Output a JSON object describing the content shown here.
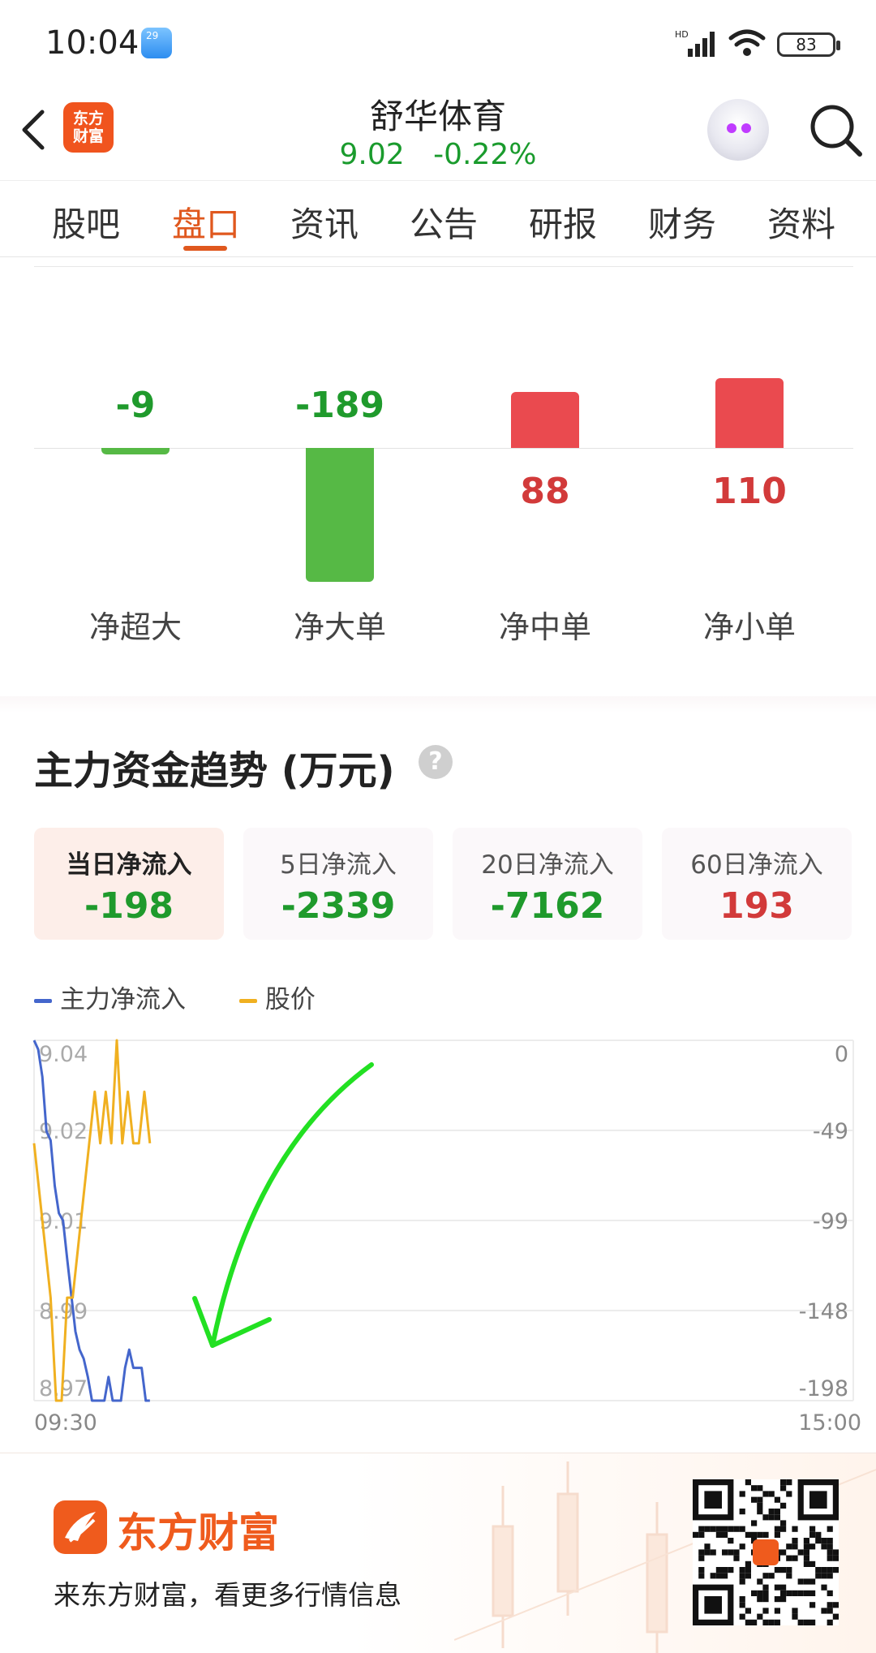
{
  "status_bar": {
    "time": "10:04",
    "weather_badge": "29",
    "battery": "83",
    "network": "HD"
  },
  "header": {
    "stock_name": "舒华体育",
    "price": "9.02",
    "change_pct": "-0.22%",
    "logo_text_line1": "东方",
    "logo_text_line2": "财富"
  },
  "tabs": [
    "股吧",
    "盘口",
    "资讯",
    "公告",
    "研报",
    "财务",
    "资料"
  ],
  "active_tab": "盘口",
  "net_flow": {
    "items": [
      {
        "label": "净超大",
        "value": "-9",
        "num": -9,
        "color": "green"
      },
      {
        "label": "净大单",
        "value": "-189",
        "num": -189,
        "color": "green"
      },
      {
        "label": "净中单",
        "value": "88",
        "num": 88,
        "color": "red"
      },
      {
        "label": "净小单",
        "value": "110",
        "num": 110,
        "color": "red"
      }
    ]
  },
  "trend": {
    "title": "主力资金趋势 (万元)",
    "help_icon": "?",
    "cards": [
      {
        "label": "当日净流入",
        "value": "-198",
        "color": "green",
        "active": true
      },
      {
        "label": "5日净流入",
        "value": "-2339",
        "color": "green",
        "active": false
      },
      {
        "label": "20日净流入",
        "value": "-7162",
        "color": "green",
        "active": false
      },
      {
        "label": "60日净流入",
        "value": "193",
        "color": "red",
        "active": false
      }
    ],
    "legend": [
      {
        "name": "主力净流入",
        "color": "#4466cc"
      },
      {
        "name": "股价",
        "color": "#f0b020"
      }
    ]
  },
  "chart_data": {
    "type": "line",
    "x_start": "09:30",
    "x_end": "15:00",
    "left_axis_ticks": [
      "9.04",
      "9.02",
      "9.01",
      "8.99",
      "8.97"
    ],
    "right_axis_ticks": [
      "0",
      "-49",
      "-99",
      "-148",
      "-198"
    ],
    "series": [
      {
        "name": "主力净流入",
        "color": "#4466cc",
        "values": [
          0,
          -5,
          -20,
          -50,
          -55,
          -80,
          -95,
          -99,
          -120,
          -140,
          -160,
          -170,
          -175,
          -185,
          -198,
          -198,
          -198,
          -198,
          -185,
          -198,
          -198,
          -198,
          -180,
          -170,
          -180,
          -180,
          -180,
          -198,
          -198
        ]
      },
      {
        "name": "股价",
        "color": "#f0b020",
        "values": [
          9.02,
          9.01,
          9.0,
          8.99,
          8.97,
          8.97,
          8.99,
          8.99,
          9.0,
          9.01,
          9.02,
          9.03,
          9.02,
          9.03,
          9.02,
          9.04,
          9.02,
          9.03,
          9.02,
          9.02,
          9.03,
          9.02
        ]
      }
    ],
    "annotation": {
      "type": "hand-drawn arrow",
      "color": "#22dd22"
    }
  },
  "footer": {
    "brand": "东方财富",
    "slogan": "来东方财富，看更多行情信息"
  }
}
